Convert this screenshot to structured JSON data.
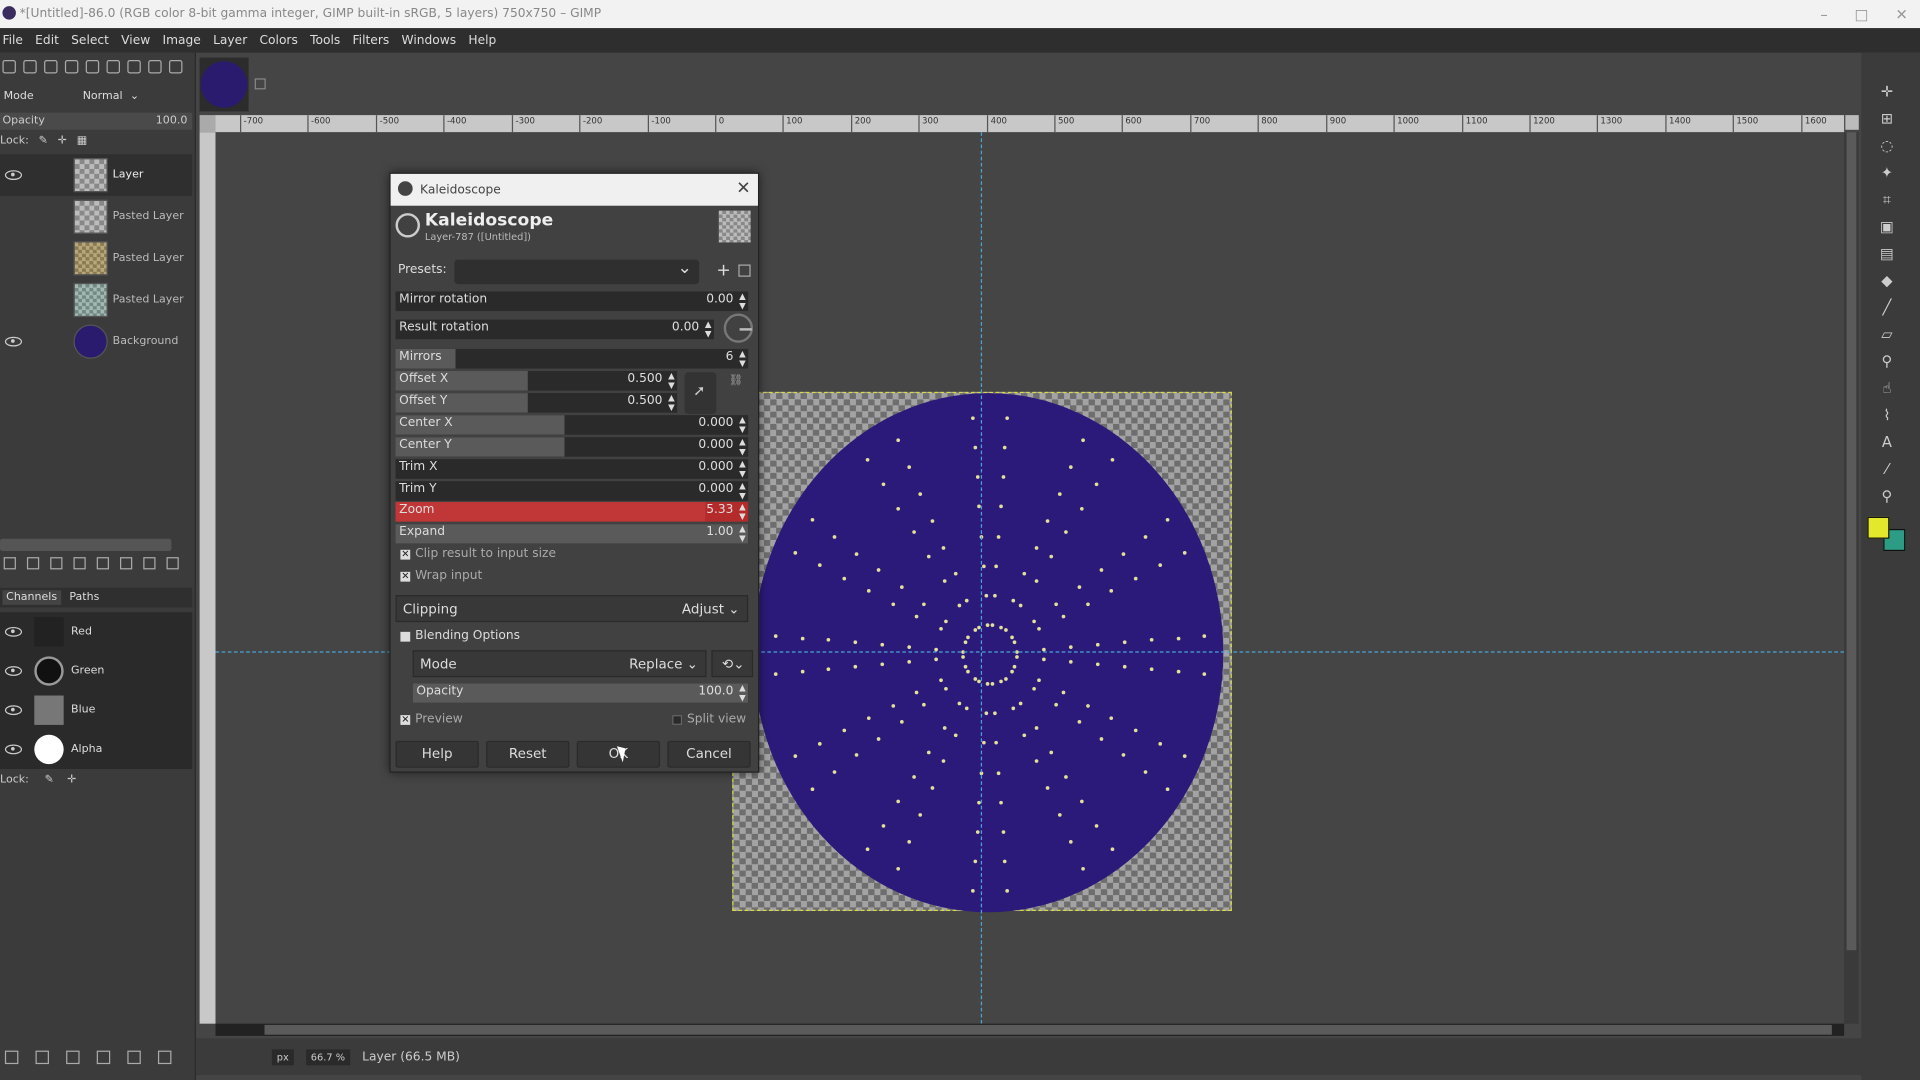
{
  "window": {
    "title": "*[Untitled]-86.0 (RGB color 8-bit gamma integer, GIMP built-in sRGB, 5 layers) 750x750 – GIMP"
  },
  "menu": [
    "File",
    "Edit",
    "Select",
    "View",
    "Image",
    "Layer",
    "Colors",
    "Tools",
    "Filters",
    "Windows",
    "Help"
  ],
  "layers_panel": {
    "mode_label": "Mode",
    "mode_value": "Normal",
    "opacity_label": "Opacity",
    "opacity_value": "100.0",
    "lock_label": "Lock:",
    "layers": [
      {
        "name": "Layer",
        "visible": true
      },
      {
        "name": "Pasted Layer",
        "visible": false
      },
      {
        "name": "Pasted Layer",
        "visible": false
      },
      {
        "name": "Pasted Layer",
        "visible": false
      },
      {
        "name": "Background",
        "visible": true
      }
    ]
  },
  "channels_panel": {
    "tab_channels": "Channels",
    "tab_paths": "Paths",
    "channels": [
      "Red",
      "Green",
      "Blue",
      "Alpha"
    ],
    "lock_label": "Lock:"
  },
  "ruler": {
    "labels": [
      "-700",
      "-600",
      "-500",
      "-400",
      "-300",
      "-200",
      "-100",
      "0",
      "100",
      "200",
      "300",
      "400",
      "500",
      "600",
      "700",
      "800",
      "900",
      "1000",
      "1100",
      "1200",
      "1300",
      "1400",
      "1500",
      "1600"
    ]
  },
  "statusbar": {
    "unit": "px",
    "zoom": "66.7 %",
    "info": "Layer (66.5 MB)"
  },
  "dialog": {
    "window_title": "Kaleidoscope",
    "heading": "Kaleidoscope",
    "subtitle": "Layer-787 ([Untitled])",
    "presets_label": "Presets:",
    "fields": {
      "mirror_rotation": {
        "label": "Mirror rotation",
        "value": "0.00"
      },
      "result_rotation": {
        "label": "Result rotation",
        "value": "0.00"
      },
      "mirrors": {
        "label": "Mirrors",
        "value": "6"
      },
      "offset_x": {
        "label": "Offset X",
        "value": "0.500"
      },
      "offset_y": {
        "label": "Offset Y",
        "value": "0.500"
      },
      "center_x": {
        "label": "Center X",
        "value": "0.000"
      },
      "center_y": {
        "label": "Center Y",
        "value": "0.000"
      },
      "trim_x": {
        "label": "Trim X",
        "value": "0.000"
      },
      "trim_y": {
        "label": "Trim Y",
        "value": "0.000"
      },
      "zoom": {
        "label": "Zoom",
        "value": "5.33"
      },
      "expand": {
        "label": "Expand",
        "value": "1.00"
      }
    },
    "clip_result": "Clip result to input size",
    "wrap_input": "Wrap input",
    "clipping_label": "Clipping",
    "clipping_value": "Adjust",
    "blending_options": "Blending Options",
    "blend_mode_label": "Mode",
    "blend_mode_value": "Replace",
    "blend_opacity_label": "Opacity",
    "blend_opacity_value": "100.0",
    "preview": "Preview",
    "split_view": "Split view",
    "buttons": {
      "help": "Help",
      "reset": "Reset",
      "ok": "OK",
      "cancel": "Cancel"
    }
  },
  "colors": {
    "foreground": "#e4e82a",
    "background": "#2d9c84",
    "image_disc": "#2c1a7a",
    "zoom_highlight": "#b52a2a"
  }
}
